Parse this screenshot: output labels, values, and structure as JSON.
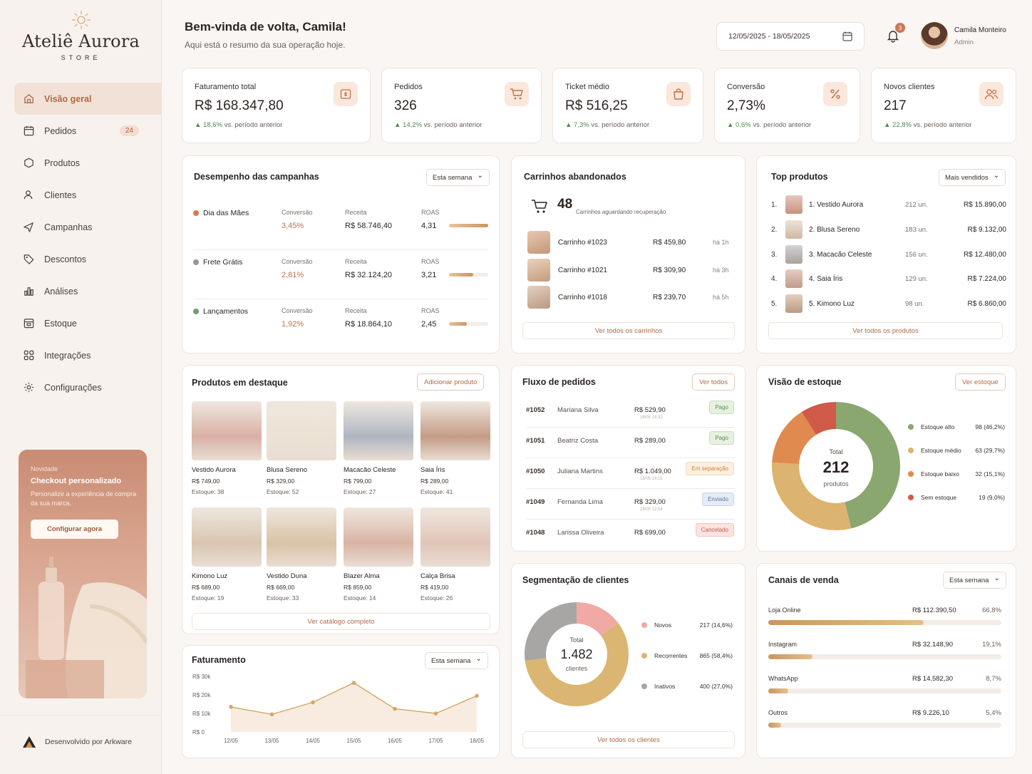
{
  "brand": {
    "name": "Ateliê Aurora",
    "sub": "STORE"
  },
  "nav": [
    {
      "label": "Visão geral",
      "icon": "home-icon",
      "active": true
    },
    {
      "label": "Pedidos",
      "icon": "calendar-icon",
      "badge": "24"
    },
    {
      "label": "Produtos",
      "icon": "box-icon"
    },
    {
      "label": "Clientes",
      "icon": "users-icon"
    },
    {
      "label": "Campanhas",
      "icon": "send-icon"
    },
    {
      "label": "Descontos",
      "icon": "tag-icon"
    },
    {
      "label": "Análises",
      "icon": "bar-chart-icon"
    },
    {
      "label": "Estoque",
      "icon": "inventory-icon"
    },
    {
      "label": "Integrações",
      "icon": "integrations-icon"
    },
    {
      "label": "Configurações",
      "icon": "gear-icon"
    }
  ],
  "promo": {
    "tag": "Novidade",
    "title": "Checkout personalizado",
    "desc": "Personalize a experiência de compra da sua marca.",
    "button": "Configurar agora"
  },
  "footer": {
    "dev": "Desenvolvido por Arkware"
  },
  "header": {
    "greeting": "Bem-vinda de volta, Camila!",
    "subtitle": "Aqui está o resumo da sua operação hoje.",
    "date_range": "12/05/2025 - 18/05/2025",
    "notifications": "3",
    "user_name": "Camila Monteiro",
    "user_role": "Admin"
  },
  "kpis": [
    {
      "label": "Faturamento total",
      "value": "R$ 168.347,80",
      "delta": "▲ 18,6%",
      "note": "vs. período anterior"
    },
    {
      "label": "Pedidos",
      "value": "326",
      "delta": "▲ 14,2%",
      "note": "vs. período anterior"
    },
    {
      "label": "Ticket médio",
      "value": "R$ 516,25",
      "delta": "▲ 7,3%",
      "note": "vs. período anterior"
    },
    {
      "label": "Conversão",
      "value": "2,73%",
      "delta": "▲ 0,6%",
      "note": "vs. período anterior"
    },
    {
      "label": "Novos clientes",
      "value": "217",
      "delta": "▲ 22,8%",
      "note": "vs. período anterior"
    }
  ],
  "campaigns": {
    "title": "Desempenho das campanhas",
    "filter": "Esta semana",
    "col_conv": "Conversão",
    "col_rev": "Receita",
    "col_roas": "ROAS",
    "rows": [
      {
        "name": "Dia das Mães",
        "color": "#d9774f",
        "conv": "3,45%",
        "rev": "R$ 58.746,40",
        "roas": "4,31",
        "fill": 1.0
      },
      {
        "name": "Frete Grátis",
        "color": "#9a9590",
        "conv": "2,81%",
        "rev": "R$ 32.124,20",
        "roas": "3,21",
        "fill": 0.62
      },
      {
        "name": "Lançamentos",
        "color": "#6da36a",
        "conv": "1,92%",
        "rev": "R$ 18.864,10",
        "roas": "2,45",
        "fill": 0.45
      }
    ]
  },
  "carts": {
    "title": "Carrinhos abandonados",
    "count": "48",
    "count_label": "Carrinhos aguardando recuperação",
    "rows": [
      {
        "id": "Carrinho #1023",
        "price": "R$ 459,80",
        "time": "há 1h"
      },
      {
        "id": "Carrinho #1021",
        "price": "R$ 309,90",
        "time": "há 3h"
      },
      {
        "id": "Carrinho #1018",
        "price": "R$ 239,70",
        "time": "há 5h"
      }
    ],
    "link": "Ver todos os carrinhos"
  },
  "top_products": {
    "title": "Top produtos",
    "filter": "Mais vendidos",
    "rows": [
      {
        "rank": "1.",
        "name": "1. Vestido Aurora",
        "units": "212 un.",
        "rev": "R$ 15.890,00"
      },
      {
        "rank": "2.",
        "name": "2. Blusa Sereno",
        "units": "183 un.",
        "rev": "R$ 9.132,00"
      },
      {
        "rank": "3.",
        "name": "3. Macacão Celeste",
        "units": "156 un.",
        "rev": "R$ 12.480,00"
      },
      {
        "rank": "4.",
        "name": "4. Saia Íris",
        "units": "129 un.",
        "rev": "R$ 7.224,00"
      },
      {
        "rank": "5.",
        "name": "5. Kimono Luz",
        "units": "98 un.",
        "rev": "R$ 6.860,00"
      }
    ],
    "link": "Ver todos os produtos"
  },
  "featured": {
    "title": "Produtos em destaque",
    "add": "Adicionar produto",
    "link": "Ver catálogo completo",
    "items": [
      {
        "name": "Vestido Aurora",
        "price": "R$ 749,00",
        "stock": "Estoque: 38",
        "tone": "#d9b0a4"
      },
      {
        "name": "Blusa Sereno",
        "price": "R$ 329,00",
        "stock": "Estoque: 52",
        "tone": "#ece2d4"
      },
      {
        "name": "Macacão Celeste",
        "price": "R$ 799,00",
        "stock": "Estoque: 27",
        "tone": "#aeb6c0"
      },
      {
        "name": "Saia Íris",
        "price": "R$ 289,00",
        "stock": "Estoque: 41",
        "tone": "#c49c86"
      },
      {
        "name": "Kimono Luz",
        "price": "R$ 689,00",
        "stock": "Estoque: 19",
        "tone": "#d9c6b0"
      },
      {
        "name": "Vestido Duna",
        "price": "R$ 669,00",
        "stock": "Estoque: 33",
        "tone": "#d8c3a6"
      },
      {
        "name": "Blazer Alma",
        "price": "R$ 859,00",
        "stock": "Estoque: 14",
        "tone": "#d9b4a4"
      },
      {
        "name": "Calça Brisa",
        "price": "R$ 419,00",
        "stock": "Estoque: 26",
        "tone": "#e2c4b8"
      }
    ]
  },
  "orders": {
    "title": "Fluxo de pedidos",
    "link": "Ver todos",
    "rows": [
      {
        "id": "#1052",
        "client": "Mariana Silva",
        "value": "R$ 529,90",
        "date": "18/05 14:32",
        "status": "Pago",
        "fg": "#5e8a4f",
        "bg": "#e7f1df"
      },
      {
        "id": "#1051",
        "client": "Beatriz Costa",
        "value": "R$ 289,00",
        "date": "",
        "status": "Pago",
        "fg": "#5e8a4f",
        "bg": "#e7f1df"
      },
      {
        "id": "#1050",
        "client": "Juliana Martins",
        "value": "R$ 1.049,00",
        "date": "18/05 14:15",
        "status": "Em separação",
        "fg": "#c9843f",
        "bg": "#fcefdf"
      },
      {
        "id": "#1049",
        "client": "Fernanda Lima",
        "value": "R$ 329,00",
        "date": "18/05 13:54",
        "status": "Enviado",
        "fg": "#5a76a6",
        "bg": "#e6ecf6"
      },
      {
        "id": "#1048",
        "client": "Larissa Oliveira",
        "value": "R$ 699,00",
        "date": "",
        "status": "Cancelado",
        "fg": "#c45a4a",
        "bg": "#fbe3df"
      }
    ]
  },
  "stock": {
    "title": "Visão de estoque",
    "link": "Ver estoque",
    "total_label": "Total",
    "total": "212",
    "unit": "produtos",
    "segments": [
      {
        "label": "Estoque alto",
        "value": "98 (46,2%)",
        "share": 46.2,
        "color": "#8aa76f"
      },
      {
        "label": "Estoque médio",
        "value": "63 (29,7%)",
        "share": 29.7,
        "color": "#dcb36f"
      },
      {
        "label": "Estoque baixo",
        "value": "32 (15,1%)",
        "share": 15.1,
        "color": "#e08a4f"
      },
      {
        "label": "Sem estoque",
        "value": "19 (9,0%)",
        "share": 9.0,
        "color": "#d05a48"
      }
    ]
  },
  "segments": {
    "title": "Segmentação de clientes",
    "total_label": "Total",
    "total": "1.482",
    "unit": "clientes",
    "link": "Ver todos os clientes",
    "items": [
      {
        "label": "Novos",
        "value": "217 (14,6%)",
        "share": 14.6,
        "color": "#f0a9a4"
      },
      {
        "label": "Recorrentes",
        "value": "865 (58,4%)",
        "share": 58.4,
        "color": "#dbb572"
      },
      {
        "label": "Inativos",
        "value": "400 (27,0%)",
        "share": 27.0,
        "color": "#a8a6a4"
      }
    ]
  },
  "channels": {
    "title": "Canais de venda",
    "filter": "Esta semana",
    "rows": [
      {
        "name": "Loja Online",
        "value": "R$ 112.390,50",
        "pct": "66,8%",
        "share": 0.668
      },
      {
        "name": "Instagram",
        "value": "R$ 32.148,90",
        "pct": "19,1%",
        "share": 0.191
      },
      {
        "name": "WhatsApp",
        "value": "R$ 14.582,30",
        "pct": "8,7%",
        "share": 0.087
      },
      {
        "name": "Outros",
        "value": "R$ 9.226,10",
        "pct": "5,4%",
        "share": 0.054
      }
    ]
  },
  "chart_data": {
    "type": "area",
    "title": "Faturamento",
    "filter": "Esta semana",
    "categories": [
      "12/05",
      "13/05",
      "14/05",
      "15/05",
      "16/05",
      "17/05",
      "18/05"
    ],
    "values": [
      13500,
      9500,
      16000,
      26500,
      12500,
      10000,
      19500
    ],
    "yticks": [
      "R$ 30k",
      "R$ 20k",
      "R$ 10k",
      "R$ 0"
    ],
    "ylim": [
      0,
      30000
    ],
    "line_color": "#d4a766",
    "grid": false
  }
}
